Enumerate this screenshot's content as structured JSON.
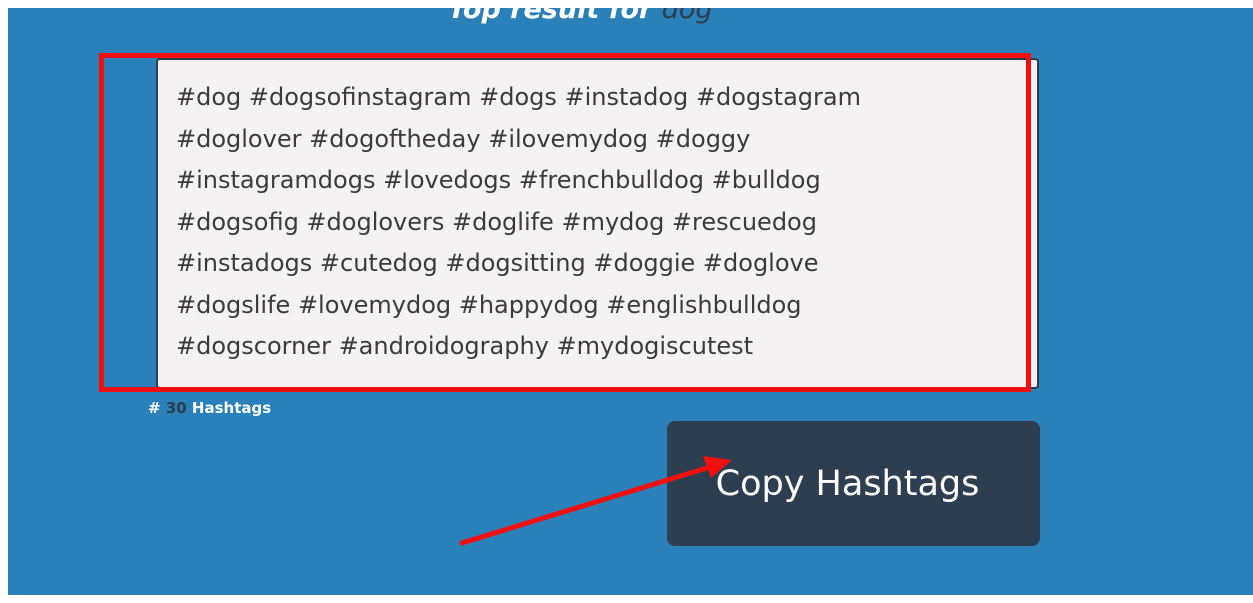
{
  "header": {
    "title_prefix": "Top result for",
    "keyword": "dog"
  },
  "hashtags": {
    "text": "#dog #dogsofinstagram #dogs #instadog #dogstagram\n#doglover #dogoftheday #ilovemydog #doggy\n#instagramdogs #lovedogs #frenchbulldog #bulldog\n#dogsofig #doglovers #doglife #mydog #rescuedog\n#instadogs #cutedog #dogsitting #doggie #doglove\n#dogslife #lovemydog #happydog #englishbulldog\n#dogscorner #androidography #mydogiscutest",
    "count_prefix": "#",
    "count": "30",
    "count_suffix": "Hashtags"
  },
  "actions": {
    "copy_label": "Copy Hashtags"
  },
  "annotations": {
    "highlight_color": "#f40f0f",
    "arrow_color": "#f40f0f"
  },
  "colors": {
    "background": "#2a80b9",
    "button": "#2c3e50",
    "textarea_bg": "#f4f2f2"
  }
}
